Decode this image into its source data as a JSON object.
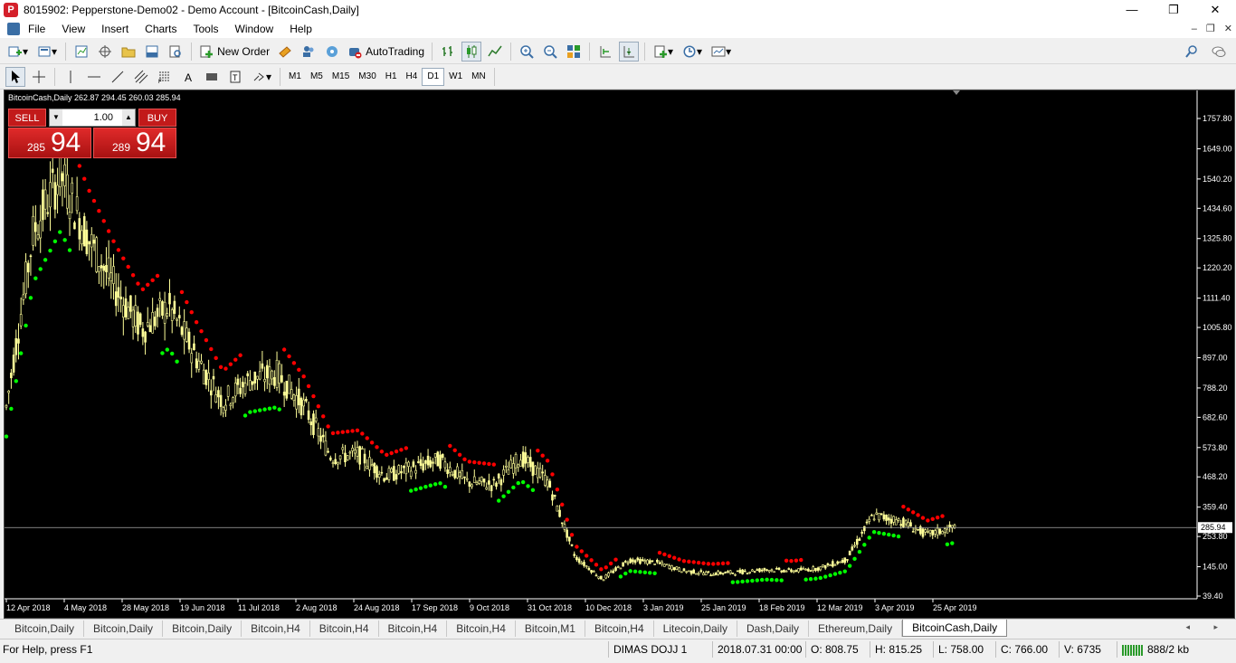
{
  "window": {
    "title": "8015902: Pepperstone-Demo02 - Demo Account - [BitcoinCash,Daily]",
    "minimize": "—",
    "maximize": "❐",
    "close": "✕"
  },
  "menu": {
    "items": [
      "File",
      "View",
      "Insert",
      "Charts",
      "Tools",
      "Window",
      "Help"
    ],
    "mdi_controls": [
      "–",
      "❐",
      "✕"
    ]
  },
  "toolbar": {
    "new_order": "New Order",
    "auto_trading": "AutoTrading",
    "timeframes": [
      "M1",
      "M5",
      "M15",
      "M30",
      "H1",
      "H4",
      "D1",
      "W1",
      "MN"
    ],
    "active_timeframe": "D1"
  },
  "chart": {
    "label": "BitcoinCash,Daily  262.87 294.45 260.03 285.94",
    "background": "#000000",
    "candle_color": "#ffff99",
    "sar_up_color": "#00ff00",
    "sar_down_color": "#ff0000",
    "price_tag": "285.94"
  },
  "trade_panel": {
    "sell_label": "SELL",
    "buy_label": "BUY",
    "lot_size": "1.00",
    "sell_price_prefix": "285",
    "sell_price_main": "94",
    "buy_price_prefix": "289",
    "buy_price_main": "94"
  },
  "chart_data": {
    "type": "candlestick",
    "symbol": "BitcoinCash",
    "timeframe": "Daily",
    "y_ticks": [
      "1757.80",
      "1649.00",
      "1540.20",
      "1434.60",
      "1325.80",
      "1220.20",
      "1111.40",
      "1005.80",
      "897.00",
      "788.20",
      "682.60",
      "573.80",
      "468.20",
      "359.40",
      "253.80",
      "145.00",
      "39.40"
    ],
    "x_ticks": [
      "12 Apr 2018",
      "4 May 2018",
      "28 May 2018",
      "19 Jun 2018",
      "11 Jul 2018",
      "2 Aug 2018",
      "24 Aug 2018",
      "17 Sep 2018",
      "9 Oct 2018",
      "31 Oct 2018",
      "10 Dec 2018",
      "3 Jan 2019",
      "25 Jan 2019",
      "18 Feb 2019",
      "12 Mar 2019",
      "3 Apr 2019",
      "25 Apr 2019"
    ],
    "ylim": [
      39.4,
      1800
    ],
    "last_price": 285.94,
    "ohlc_last": {
      "open": 262.87,
      "high": 294.45,
      "low": 260.03,
      "close": 285.94
    },
    "close_series": [
      {
        "x": "12 Apr 2018",
        "y": 720
      },
      {
        "x": "20 Apr 2018",
        "y": 1350
      },
      {
        "x": "4 May 2018",
        "y": 1560
      },
      {
        "x": "12 May 2018",
        "y": 1330
      },
      {
        "x": "20 May 2018",
        "y": 1150
      },
      {
        "x": "28 May 2018",
        "y": 1000
      },
      {
        "x": "8 Jun 2018",
        "y": 1080
      },
      {
        "x": "19 Jun 2018",
        "y": 900
      },
      {
        "x": "30 Jun 2018",
        "y": 740
      },
      {
        "x": "11 Jul 2018",
        "y": 820
      },
      {
        "x": "20 Jul 2018",
        "y": 840
      },
      {
        "x": "2 Aug 2018",
        "y": 720
      },
      {
        "x": "12 Aug 2018",
        "y": 540
      },
      {
        "x": "24 Aug 2018",
        "y": 550
      },
      {
        "x": "5 Sep 2018",
        "y": 470
      },
      {
        "x": "17 Sep 2018",
        "y": 500
      },
      {
        "x": "28 Sep 2018",
        "y": 530
      },
      {
        "x": "9 Oct 2018",
        "y": 450
      },
      {
        "x": "20 Oct 2018",
        "y": 440
      },
      {
        "x": "31 Oct 2018",
        "y": 540
      },
      {
        "x": "12 Nov 2018",
        "y": 450
      },
      {
        "x": "20 Nov 2018",
        "y": 180
      },
      {
        "x": "10 Dec 2018",
        "y": 100
      },
      {
        "x": "20 Dec 2018",
        "y": 170
      },
      {
        "x": "3 Jan 2019",
        "y": 160
      },
      {
        "x": "15 Jan 2019",
        "y": 130
      },
      {
        "x": "25 Jan 2019",
        "y": 120
      },
      {
        "x": "5 Feb 2019",
        "y": 125
      },
      {
        "x": "18 Feb 2019",
        "y": 135
      },
      {
        "x": "28 Feb 2019",
        "y": 130
      },
      {
        "x": "12 Mar 2019",
        "y": 140
      },
      {
        "x": "25 Mar 2019",
        "y": 170
      },
      {
        "x": "3 Apr 2019",
        "y": 330
      },
      {
        "x": "15 Apr 2019",
        "y": 310
      },
      {
        "x": "25 Apr 2019",
        "y": 260
      },
      {
        "x": "30 Apr 2019",
        "y": 286
      }
    ]
  },
  "tabs": [
    "Bitcoin,Daily",
    "Bitcoin,Daily",
    "Bitcoin,Daily",
    "Bitcoin,H4",
    "Bitcoin,H4",
    "Bitcoin,H4",
    "Bitcoin,H4",
    "Bitcoin,M1",
    "Bitcoin,H4",
    "Litecoin,Daily",
    "Dash,Daily",
    "Ethereum,Daily",
    "BitcoinCash,Daily"
  ],
  "active_tab": "BitcoinCash,Daily",
  "tab_arrows": "◂ ▸",
  "status": {
    "help": "For Help, press F1",
    "profile": "DIMAS DOJJ 1",
    "datetime": "2018.07.31 00:00",
    "open": "O: 808.75",
    "high": "H: 815.25",
    "low": "L: 758.00",
    "close": "C: 766.00",
    "volume": "V: 6735",
    "traffic": "888/2 kb"
  }
}
